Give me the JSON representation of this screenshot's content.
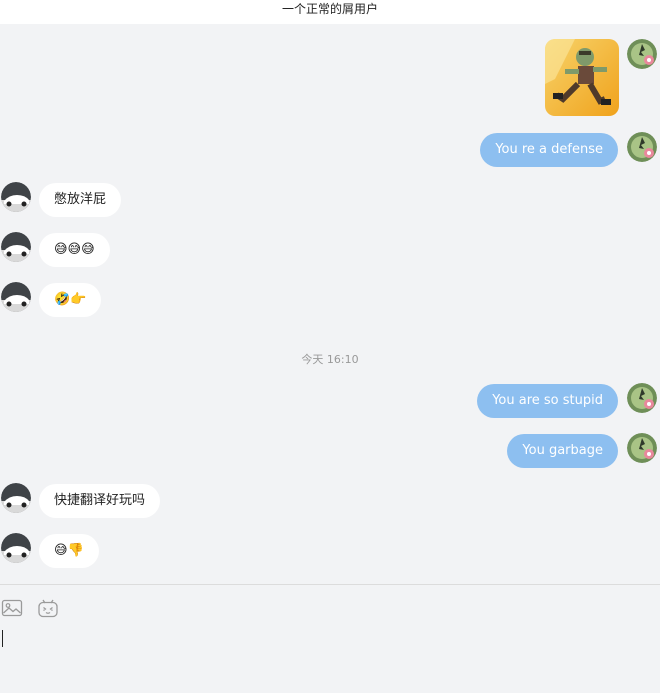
{
  "window": {
    "title": "一个正常的屑用户"
  },
  "messages": [
    {
      "side": "out",
      "kind": "image",
      "image_desc": "zombie-sticker"
    },
    {
      "side": "out",
      "text": "You re a defense"
    },
    {
      "side": "in",
      "text": "憋放洋屁"
    },
    {
      "side": "in",
      "text": "😅😅😅"
    },
    {
      "side": "in",
      "text": "🤣👉"
    },
    {
      "kind": "time",
      "text": "今天 16:10"
    },
    {
      "side": "out",
      "text": "You are so stupid"
    },
    {
      "side": "out",
      "text": "You garbage"
    },
    {
      "side": "in",
      "text": "快捷翻译好玩吗"
    },
    {
      "side": "in",
      "text": "😅👎"
    }
  ],
  "toolbar": {
    "icons": [
      "image-icon",
      "emoji-icon"
    ]
  },
  "input": {
    "value": ""
  },
  "colors": {
    "outgoing_bubble": "#8dbff0",
    "incoming_bubble": "#ffffff",
    "background": "#f2f3f5"
  }
}
